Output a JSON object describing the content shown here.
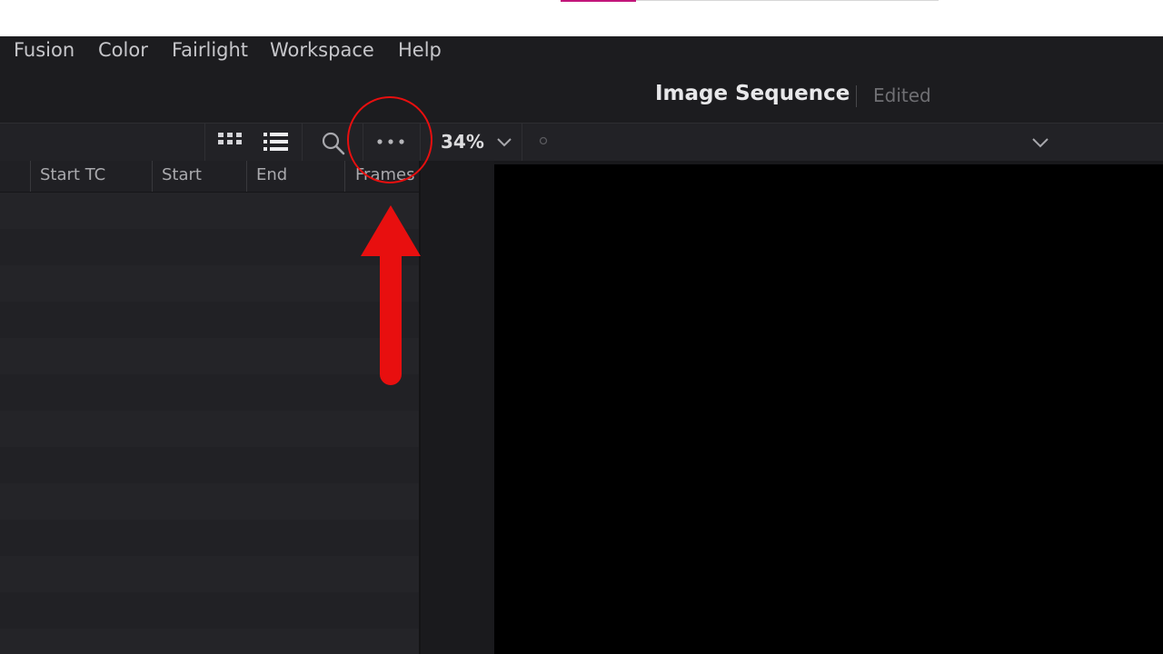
{
  "menu": {
    "items": [
      "Fusion",
      "Color",
      "Fairlight",
      "Workspace",
      "Help"
    ]
  },
  "project": {
    "title": "Image Sequence",
    "status": "Edited"
  },
  "toolbar": {
    "view_grid_icon": "grid-view-icon",
    "view_list_icon": "list-view-icon",
    "search_icon": "search-icon",
    "more_icon": "more-options-icon",
    "zoom": "34%",
    "zoom_dropdown_icon": "chevron-down-icon",
    "viewer_dropdown_icon": "chevron-down-icon"
  },
  "media_pool": {
    "columns": [
      "Start TC",
      "Start",
      "End",
      "Frames"
    ]
  },
  "annotation": {
    "color": "#e80f0f"
  }
}
